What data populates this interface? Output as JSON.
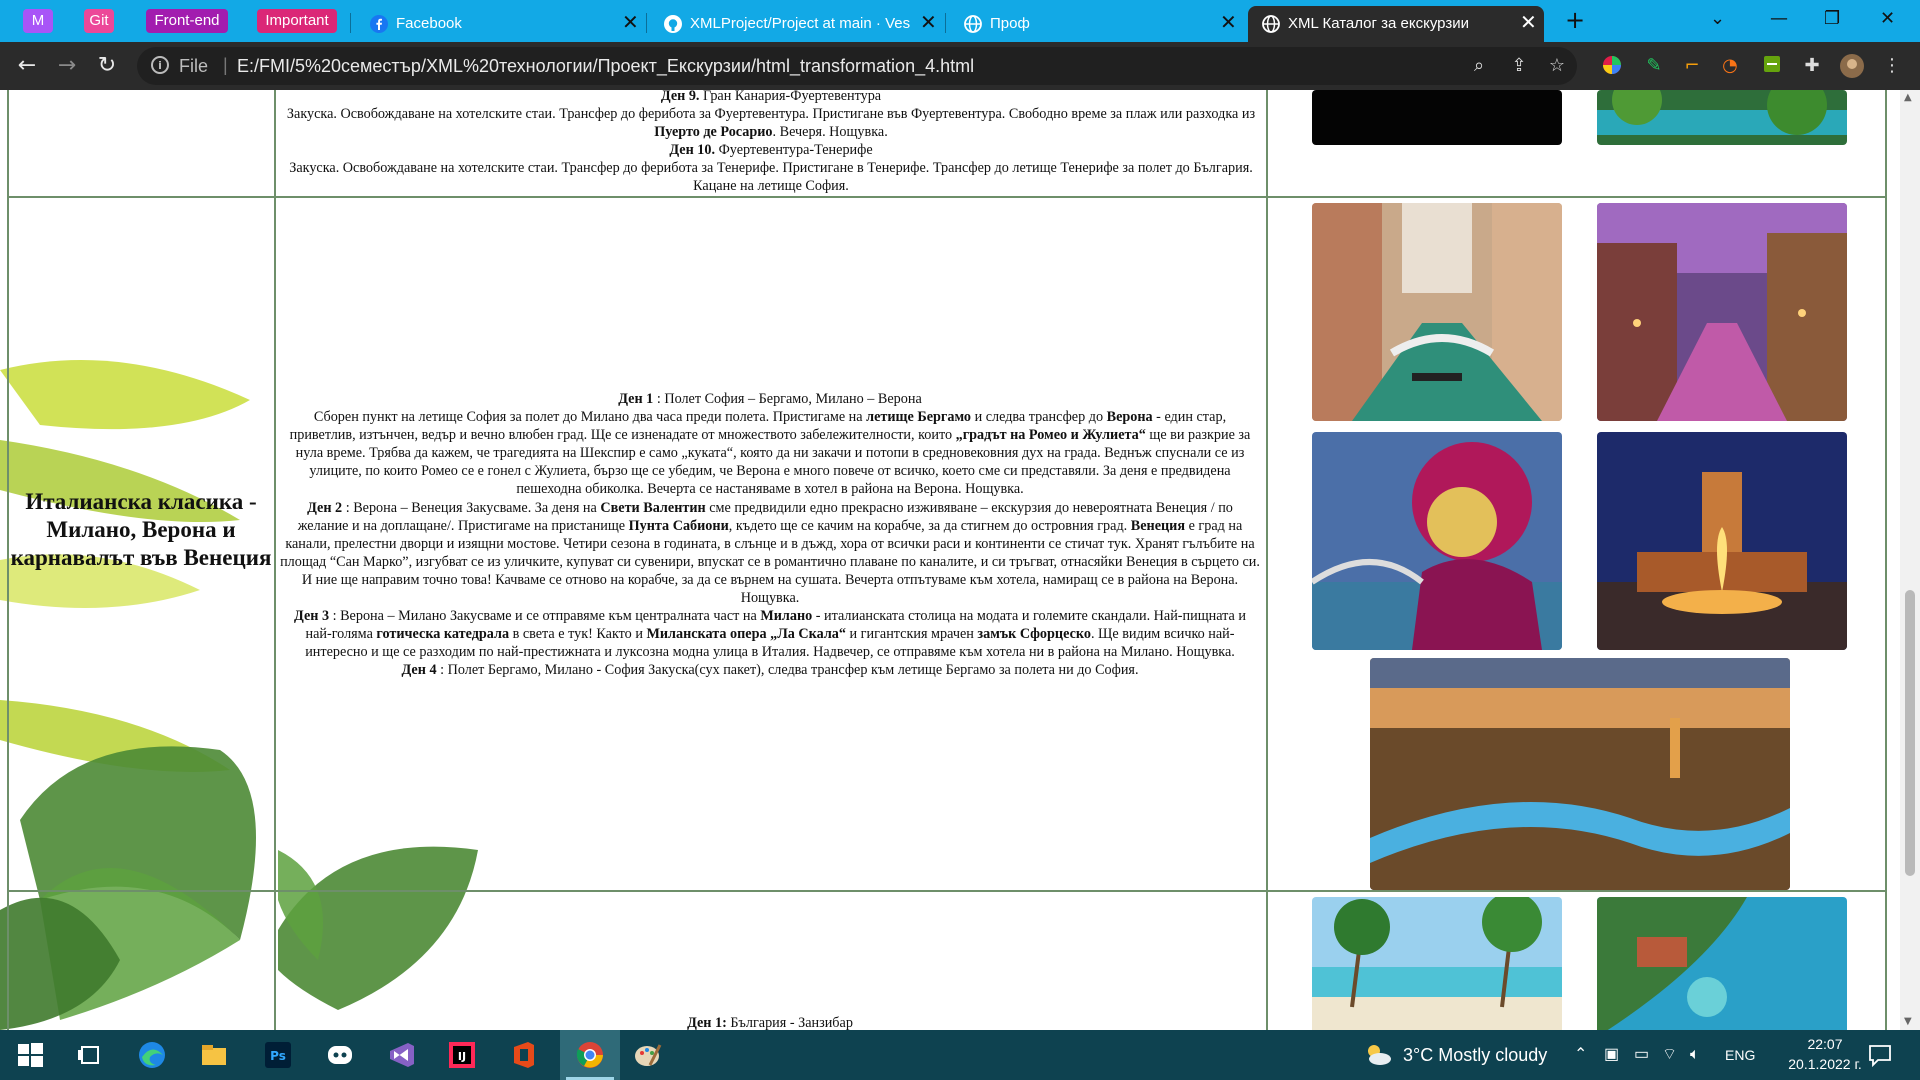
{
  "browser": {
    "tab_groups": [
      {
        "label": "M",
        "color": "#a855f7"
      },
      {
        "label": "Git",
        "color": "#ec4899"
      },
      {
        "label": "Front-end",
        "color": "#a21caf"
      },
      {
        "label": "Important",
        "color": "#db2777"
      }
    ],
    "tabs": [
      {
        "title": "Facebook",
        "icon": "facebook-icon"
      },
      {
        "title": "XMLProject/Project at main · Vesela",
        "icon": "github-icon"
      },
      {
        "title": "Проф",
        "icon": "globe-icon"
      },
      {
        "title": "XML Каталог за екскурзии",
        "icon": "globe-icon",
        "active": true
      }
    ],
    "new_tab": "+",
    "address": {
      "file_label": "File",
      "url": "E:/FMI/5%20семестър/XML%20технологии/Проект_Екскурзии/html_transformation_4.html"
    }
  },
  "page": {
    "top_row": {
      "day9_title": "Ден 9.",
      "day9_route": " Гран Канария-Фуертевентура",
      "day9_text_a": "Закуска. Освобождаване на хотелските стаи. Трансфер до фериботa за Фуертевентура. Пристигане във Фуертевентура. Свободно време за плаж или разходка из ",
      "day9_bold": "Пуерто де Росарио",
      "day9_text_b": ". Вечеря. Нощувка.",
      "day10_title": "Ден 10.",
      "day10_route": " Фуертевентура-Тенерифе",
      "day10_text": "Закуска. Освобождаване на хотелските стаи. Трансфер до фериботa за Тенерифе. Пристигане в Тенерифе. Трансфер до летище Тенерифе за полет до България. Кацане на летище София."
    },
    "italy": {
      "name": "Италианска класика - Милано, Верона и карнавалът във Венеция",
      "d1_title": "Ден 1",
      "d1_route": " : Полет София – Бергамо, Милано – Верона",
      "d1_a": "Сборен пункт на летище София за полет до Милано два часа преди полета. Пристигаме на ",
      "d1_b1": "летище Бергамо",
      "d1_c": " и следва трансфер до ",
      "d1_b2": "Верона",
      "d1_d": " - един стар, приветлив, изтънчен, ведър и вечно влюбен град. Ще се изненадате от множеството забележителности, които ",
      "d1_b3": "„градът на Ромео и Жулиета“",
      "d1_e": " ще ви разкрие за нула време. Трябва да кажем, че трагедията на Шекспир е само „куката“, която да ни закачи и потопи в средновековния дух на града. Веднъж спуснали се из улиците, по които Ромео се е гонел с Жулиета, бързо ще се убедим, че Верона е много повече от всичко, което сме си представяли. За деня е предвидена пешеходна обиколка. Вечерта се настаняваме в хотел в района на Верона. Нощувка.",
      "d2_title": "Ден 2",
      "d2_a": " : Верона – Венеция Закусваме. За деня на ",
      "d2_b1": "Свети Валентин",
      "d2_c": " сме предвидили едно прекрасно изживяване – екскурзия до невероятната Венеция / по желание и на доплащане/. Пристигаме на пристанище ",
      "d2_b2": "Пунта Сабиони",
      "d2_d": ", където ще се качим на корабче, за да стигнем до островния град. ",
      "d2_b3": "Венеция",
      "d2_e": " е град на канали, прелестни дворци и изящни мостове. Четири сезона в годината, в слънце и в дъжд, хора от всички раси и континенти се стичат тук. Хранят гълъбите на площад “Сан Марко”, изгубват се из уличките, купуват си сувенири, впускат се в романтично плаване по каналите, и си тръгват, отнасяйки Венеция в сърцето си. И ние ще направим точно това! Качваме се отново на корабче, за да се върнем на сушата. Вечерта отпътуваме към хотела, намиращ се в района на Верона. Нощувка.",
      "d3_title": "Ден 3",
      "d3_a": " : Верона – Милано Закусваме и се отправяме към централната част на ",
      "d3_b1": "Милано",
      "d3_c": " - италианската столица на модата и големите скандали. Най-пищната и най-голяма ",
      "d3_b2": "готическа катедрала",
      "d3_d": " в света е тук! Както и ",
      "d3_b3": "Миланската опера „Ла Скала“",
      "d3_e": " и гигантския мрачен ",
      "d3_b4": "замък Сфорцеско",
      "d3_f": ". Ще видим всичко най-интересно и ще се разходим по най-престижната и луксозна модна улица в Италия. Надвечер, се отправяме към хотела ни в района на Милано. Нощувка.",
      "d4_title": "Ден 4",
      "d4_a": " : Полет Бергамо, Милано - София Закуска(сух пакет), следва трансфер към летище Бергамо за полета ни до София."
    },
    "zanzibar": {
      "d1_title": "Ден 1:",
      "d1_route": " България - Занзибар"
    }
  },
  "taskbar": {
    "weather": "3°C  Mostly cloudy",
    "lang": "ENG",
    "time": "22:07",
    "date": "20.1.2022 г."
  },
  "colors": {
    "tabstrip": "#12a9e6",
    "toolbar": "#2b2b2b",
    "table_border": "#6e8f6a",
    "taskbar": "#0e4250"
  }
}
